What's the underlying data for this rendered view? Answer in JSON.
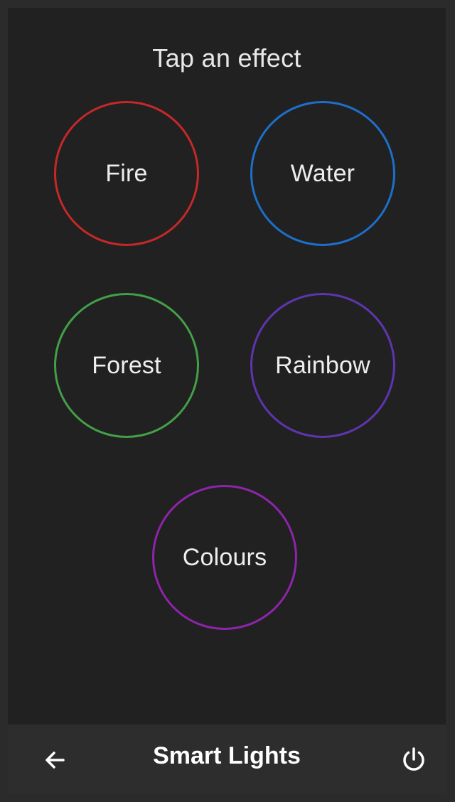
{
  "main": {
    "title": "Tap an effect",
    "effects": [
      {
        "label": "Fire",
        "color": "#c62828"
      },
      {
        "label": "Water",
        "color": "#1e6fcc"
      },
      {
        "label": "Forest",
        "color": "#43a047"
      },
      {
        "label": "Rainbow",
        "color": "#5e35b1"
      },
      {
        "label": "Colours",
        "color": "#8e24aa"
      }
    ]
  },
  "bottom_bar": {
    "title": "Smart Lights",
    "back_icon": "arrow-left-icon",
    "power_icon": "power-icon"
  },
  "colors": {
    "background": "#2b2b2b",
    "panel": "#212121",
    "bar": "#2d2d2d",
    "text": "#eeeeee"
  }
}
